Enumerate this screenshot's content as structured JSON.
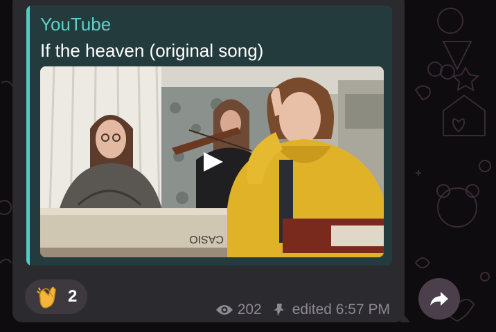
{
  "link_preview": {
    "site_name": "YouTube",
    "title": "If the heaven (original song)",
    "thumbnail": {
      "brand_text": "CASIO"
    }
  },
  "reaction": {
    "emoji": "clapping-hands-icon",
    "count": "2"
  },
  "meta": {
    "views": "202",
    "edited_label": "edited 6:57 PM"
  },
  "icons": {
    "views": "eye-icon",
    "pinned": "pin-icon",
    "share": "share-arrow-icon",
    "play": "play-icon"
  },
  "colors": {
    "accent": "#5fcfc8",
    "preview_bg": "#243b3e",
    "bubble_bg": "#2b2a2e",
    "meta_text": "#8d8a92",
    "chat_bg": "#0e0c0f"
  }
}
